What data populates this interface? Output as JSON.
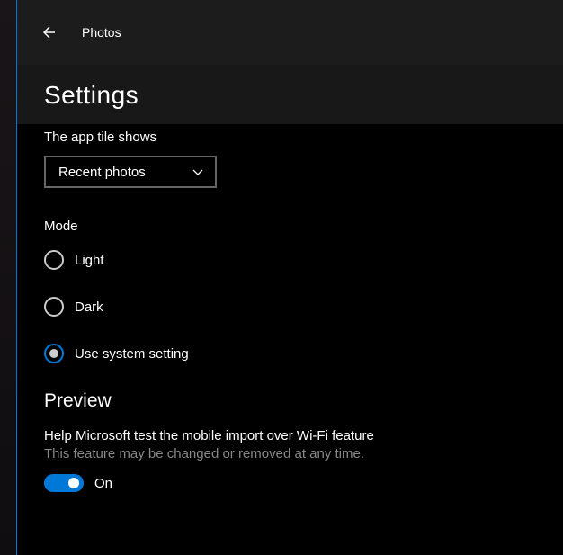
{
  "app": {
    "title": "Photos"
  },
  "page": {
    "title": "Settings"
  },
  "tile": {
    "label": "The app tile shows",
    "selected": "Recent photos"
  },
  "mode": {
    "label": "Mode",
    "options": [
      "Light",
      "Dark",
      "Use system setting"
    ],
    "selected_index": 2
  },
  "preview": {
    "heading": "Preview",
    "help": "Help Microsoft test the mobile import over Wi-Fi feature",
    "sub": "This feature may be changed or removed at any time.",
    "toggle_state": "On",
    "toggle_on": true
  }
}
